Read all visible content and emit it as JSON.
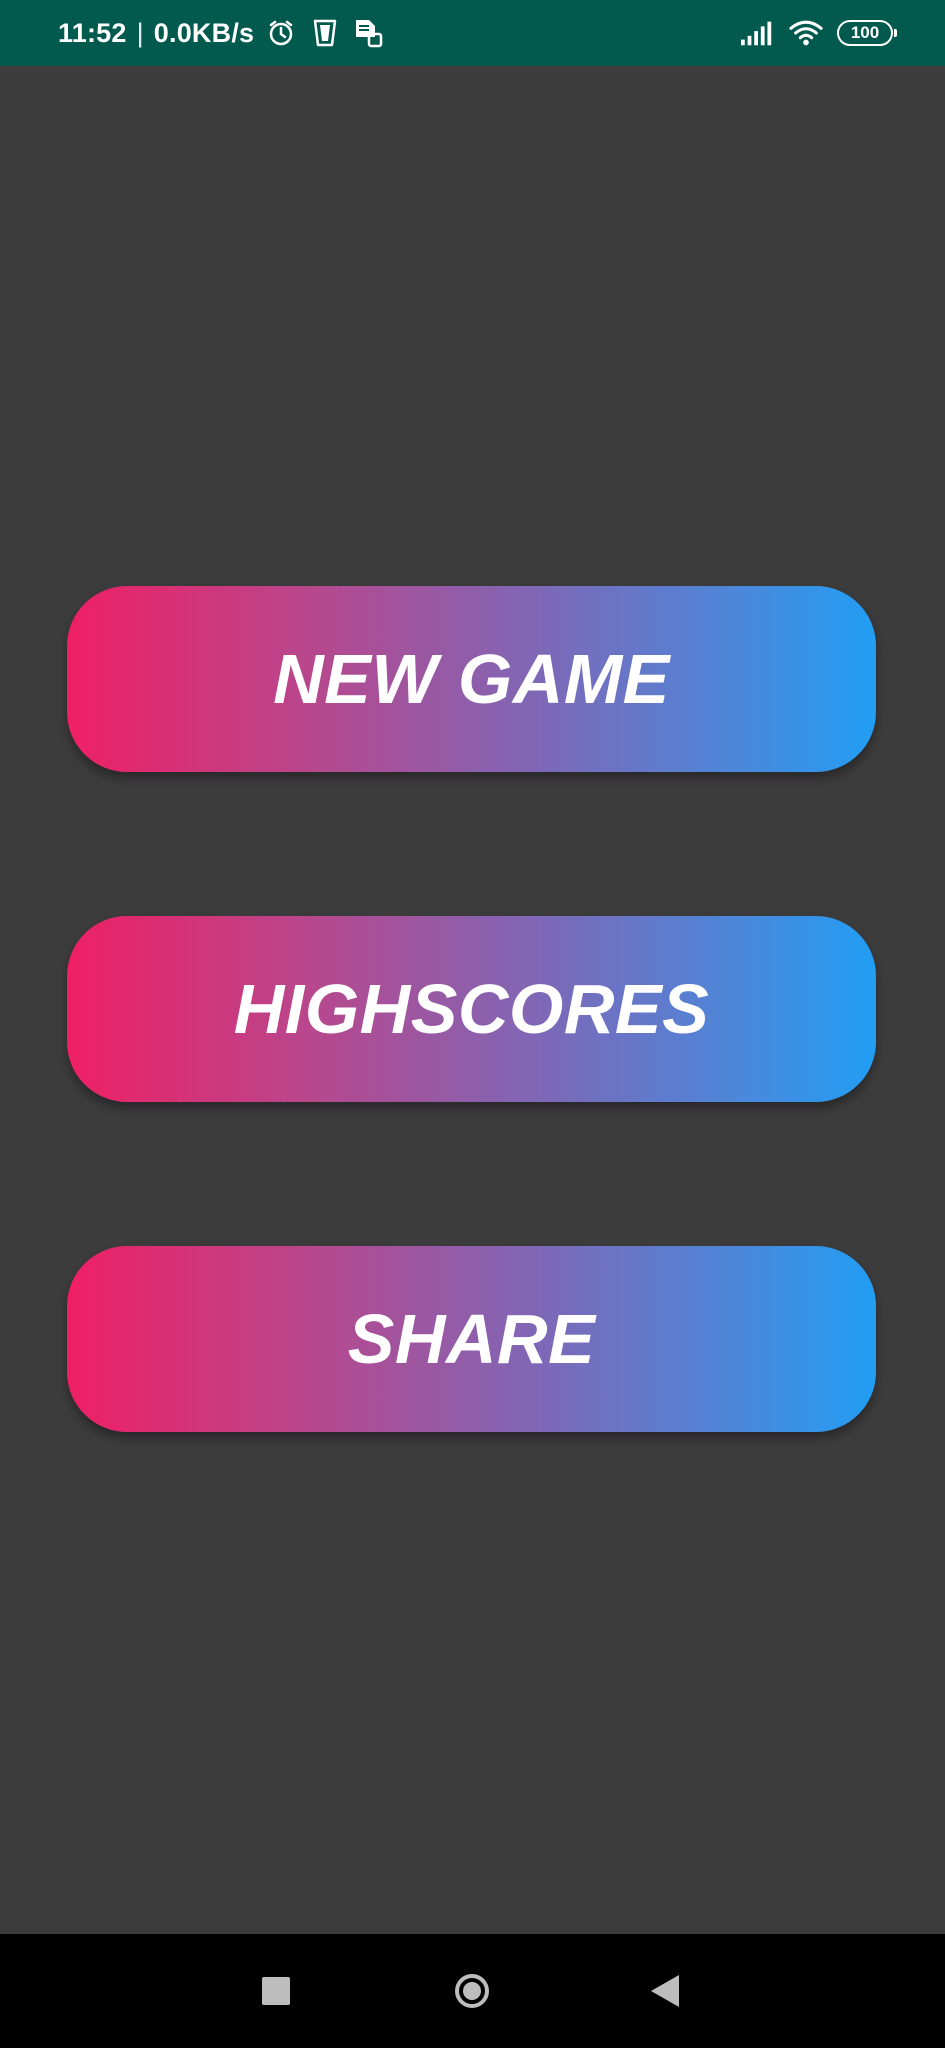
{
  "status_bar": {
    "time": "11:52",
    "separator": "|",
    "network_speed": "0.0KB/s",
    "battery_level": "100",
    "icons": [
      "alarm-icon",
      "cup-icon",
      "sim-card-icon",
      "signal-icon",
      "wifi-icon",
      "battery-icon"
    ]
  },
  "menu": {
    "new_game_label": "NEW GAME",
    "highscores_label": "HIGHSCORES",
    "share_label": "SHARE"
  },
  "navigation": {
    "icons": [
      "recents-icon",
      "home-icon",
      "back-icon"
    ]
  },
  "colors": {
    "background": "#3d3c3d",
    "status_bar": "#025a4f",
    "gradient_start": "#ef1f64",
    "gradient_end": "#219ef4",
    "nav_bar": "#000000"
  }
}
